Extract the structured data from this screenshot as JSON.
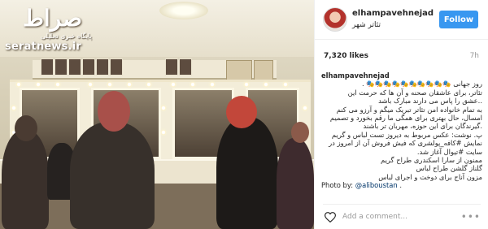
{
  "watermark": {
    "brand": "صراط",
    "tagline": "پایگاه خبری تحلیلی",
    "url": "seratnews.ir"
  },
  "post": {
    "username": "elhampavehnejad",
    "location": "تئاتر شهر",
    "follow_label": "Follow",
    "likes": "7,320 likes",
    "time": "7h",
    "caption_user": "elhampavehnejad",
    "caption_lines": [
      "روز جهانی 🎭🎭🎭🎭🎭🎭🎭🎭🎭🎭 .",
      "تئاتر، برای عاشقان صحنه و آن ها که حرمت این",
      "..عشق را پاس می دارند مبارک باشد",
      "به تمام خانواده امن تئاتر تبریک میگم و آرزو می کنم",
      "امسال، حال بهتری برای همگی ما رقم بخورد و تصمیم",
      ".گیرندگان برای این حوزه، مهربان تر باشند",
      "پ. نوشت: عکس مربوط به دیروز تست لباس و گریم",
      "نمایش #کافه_پولشری که فیش فروش آن از امروز در",
      "سایت #تیوال آغاز شد.",
      "ممنون از سارا اسکندری طراح گریم",
      "گلناز گلشن طراح لباس",
      "مزون آناج برای دوخت و اجرای لباس"
    ],
    "credit_prefix": "Photo by: ",
    "credit_mention": "@aliboustan",
    "credit_suffix": " .",
    "comment_placeholder": "Add a comment..."
  },
  "icons": {
    "like": "heart-icon",
    "more": "more-options-icon"
  },
  "colors": {
    "follow_button": "#3897f0",
    "text": "#262626",
    "muted": "#999999"
  }
}
